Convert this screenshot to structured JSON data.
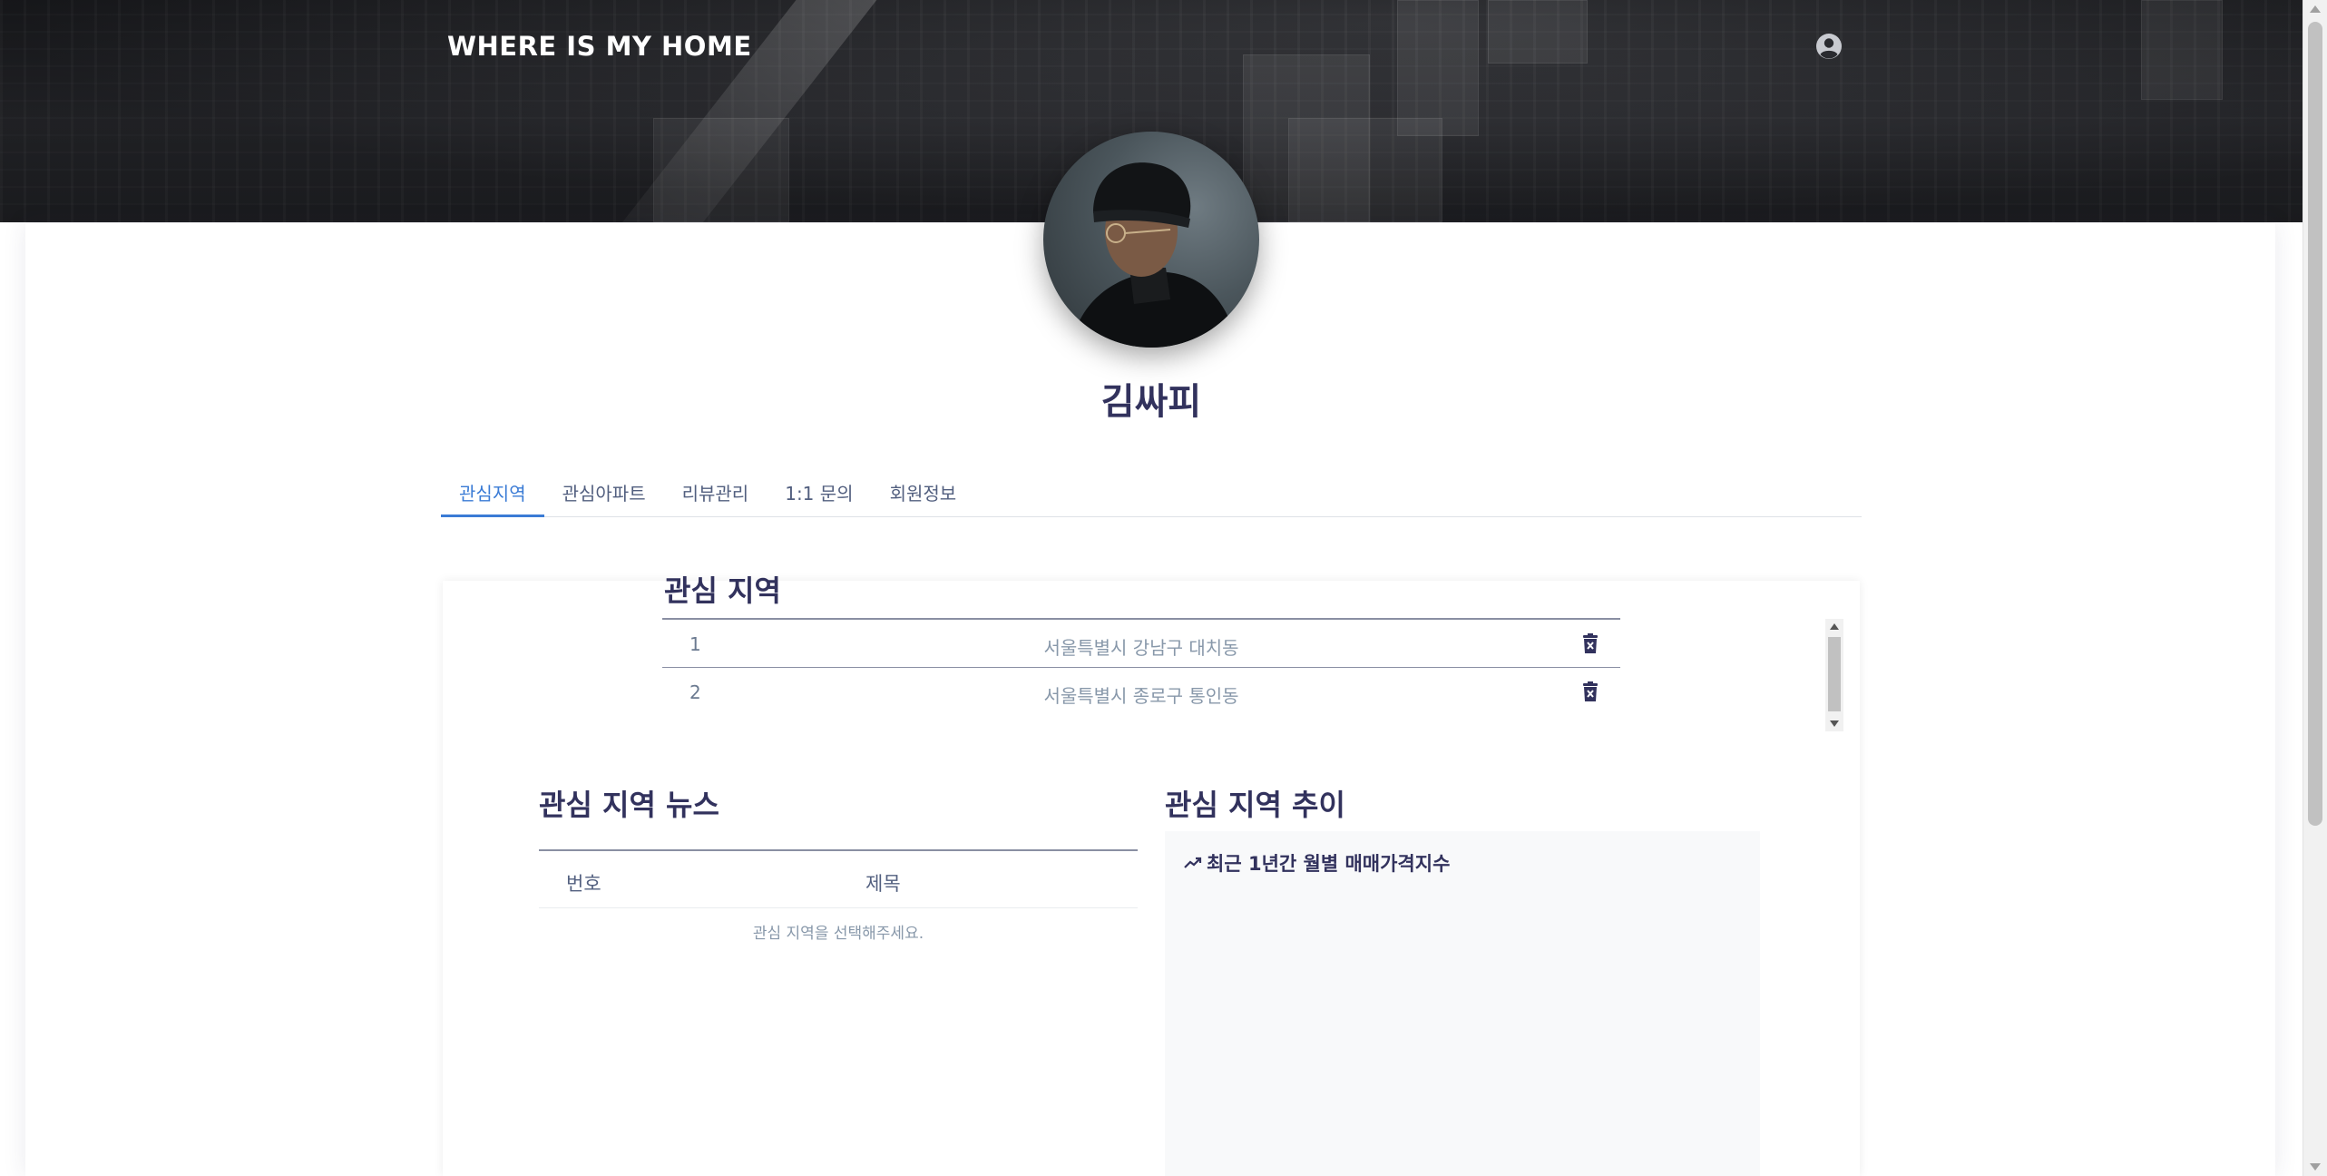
{
  "header": {
    "brand": "WHERE IS MY HOME",
    "user_icon": "user-circle-icon"
  },
  "profile": {
    "name": "김싸피"
  },
  "tabs": [
    {
      "label": "관심지역",
      "active": true
    },
    {
      "label": "관심아파트",
      "active": false
    },
    {
      "label": "리뷰관리",
      "active": false
    },
    {
      "label": "1:1 문의",
      "active": false
    },
    {
      "label": "회원정보",
      "active": false
    }
  ],
  "interest_regions": {
    "title": "관심 지역",
    "items": [
      {
        "num": "1",
        "name": "서울특별시 강남구 대치동",
        "delete_icon": "trash-icon"
      },
      {
        "num": "2",
        "name": "서울특별시 종로구 통인동",
        "delete_icon": "trash-icon"
      }
    ]
  },
  "news": {
    "title": "관심 지역 뉴스",
    "columns": [
      "번호",
      "제목"
    ],
    "empty_message": "관심 지역을 선택해주세요."
  },
  "trend": {
    "title": "관심 지역 추이",
    "chart_title": "최근 1년간 월별 매매가격지수",
    "chart_icon": "trending-up-icon"
  },
  "colors": {
    "accent": "#3a7bd5",
    "heading": "#32325d",
    "muted": "#8898aa"
  }
}
